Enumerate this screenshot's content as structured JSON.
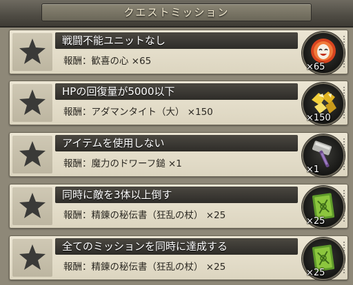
{
  "header": {
    "title": "クエストミッション"
  },
  "missions": [
    {
      "title": "戦闘不能ユニットなし",
      "reward": "報酬：歓喜の心 ×65",
      "qty": "×65",
      "item_icon": "joy-heart-icon"
    },
    {
      "title": "HPの回復量が5000以下",
      "reward": "報酬：アダマンタイト（大） ×150",
      "qty": "×150",
      "item_icon": "adamantite-icon"
    },
    {
      "title": "アイテムを使用しない",
      "reward": "報酬：魔力のドワーフ鎚 ×1",
      "qty": "×1",
      "item_icon": "dwarf-hammer-icon"
    },
    {
      "title": "同時に敵を3体以上倒す",
      "reward": "報酬：精錬の秘伝書（狂乱の杖） ×25",
      "qty": "×25",
      "item_icon": "secret-book-icon"
    },
    {
      "title": "全てのミッションを同時に達成する",
      "reward": "報酬：精錬の秘伝書（狂乱の杖） ×25",
      "qty": "×25",
      "item_icon": "secret-book-icon"
    }
  ],
  "colors": {
    "star_empty": "#3a3a38",
    "row_bg": "#e6e0cc",
    "title_band": "#3b3935"
  }
}
